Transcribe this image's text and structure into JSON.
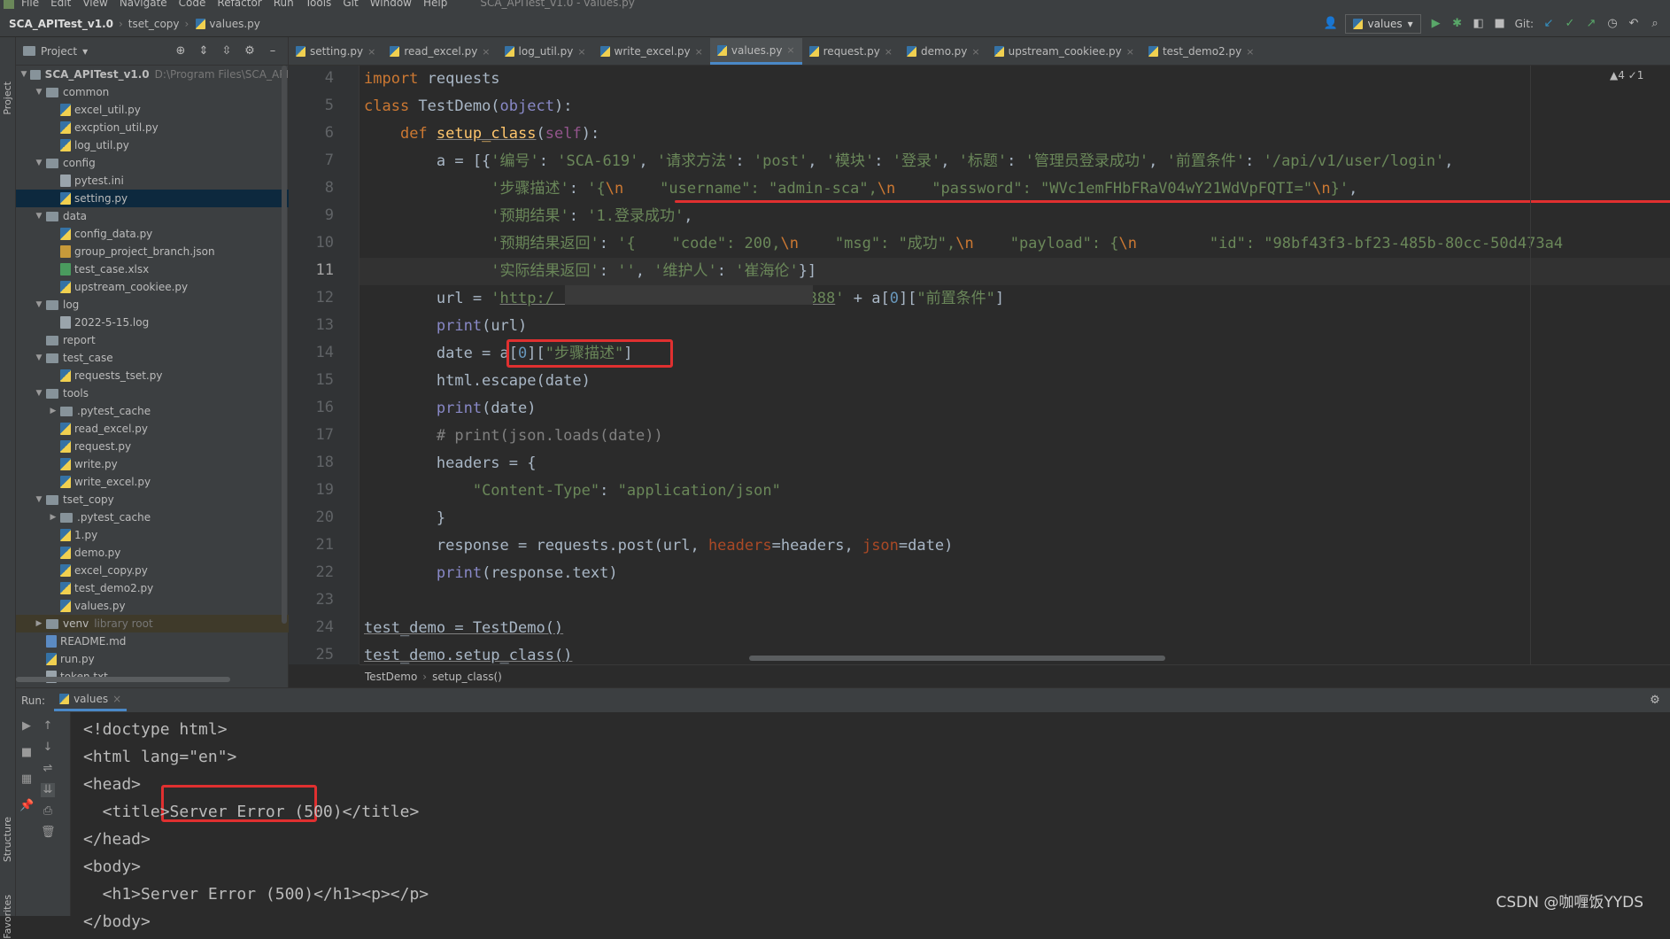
{
  "menu": {
    "items": [
      "File",
      "Edit",
      "View",
      "Navigate",
      "Code",
      "Refactor",
      "Run",
      "Tools",
      "Git",
      "Window",
      "Help"
    ],
    "window_title": "SCA_APITest_v1.0 - values.py"
  },
  "nav": {
    "project": "SCA_APITest_v1.0",
    "folder": "tset_copy",
    "file": "values.py",
    "run_config": "values",
    "git_label": "Git:"
  },
  "left_tabs": {
    "project": "Project",
    "structure": "Structure",
    "favorites": "Favorites"
  },
  "project_panel": {
    "title": "Project",
    "root": "SCA_APITest_v1.0",
    "root_path": "D:\\Program Files\\SCA_API",
    "rows": [
      {
        "label": "common",
        "kind": "folder",
        "depth": 1,
        "open": true
      },
      {
        "label": "excel_util.py",
        "kind": "py",
        "depth": 2
      },
      {
        "label": "excption_util.py",
        "kind": "py",
        "depth": 2
      },
      {
        "label": "log_util.py",
        "kind": "py",
        "depth": 2
      },
      {
        "label": "config",
        "kind": "folder",
        "depth": 1,
        "open": true
      },
      {
        "label": "pytest.ini",
        "kind": "txt",
        "depth": 2
      },
      {
        "label": "setting.py",
        "kind": "py",
        "depth": 2,
        "selected": true
      },
      {
        "label": "data",
        "kind": "folder",
        "depth": 1,
        "open": true
      },
      {
        "label": "config_data.py",
        "kind": "py",
        "depth": 2
      },
      {
        "label": "group_project_branch.json",
        "kind": "json",
        "depth": 2
      },
      {
        "label": "test_case.xlsx",
        "kind": "xls",
        "depth": 2
      },
      {
        "label": "upstream_cookiee.py",
        "kind": "py",
        "depth": 2
      },
      {
        "label": "log",
        "kind": "folder",
        "depth": 1,
        "open": true
      },
      {
        "label": "2022-5-15.log",
        "kind": "txt",
        "depth": 2
      },
      {
        "label": "report",
        "kind": "folder",
        "depth": 1
      },
      {
        "label": "test_case",
        "kind": "folder",
        "depth": 1,
        "open": true
      },
      {
        "label": "requests_tset.py",
        "kind": "py",
        "depth": 2
      },
      {
        "label": "tools",
        "kind": "folder",
        "depth": 1,
        "open": true
      },
      {
        "label": ".pytest_cache",
        "kind": "folder",
        "depth": 2,
        "closed": true
      },
      {
        "label": "read_excel.py",
        "kind": "py",
        "depth": 2
      },
      {
        "label": "request.py",
        "kind": "py",
        "depth": 2
      },
      {
        "label": "write.py",
        "kind": "py",
        "depth": 2
      },
      {
        "label": "write_excel.py",
        "kind": "py",
        "depth": 2
      },
      {
        "label": "tset_copy",
        "kind": "folder",
        "depth": 1,
        "open": true
      },
      {
        "label": ".pytest_cache",
        "kind": "folder",
        "depth": 2,
        "closed": true
      },
      {
        "label": "1.py",
        "kind": "py",
        "depth": 2
      },
      {
        "label": "demo.py",
        "kind": "py",
        "depth": 2
      },
      {
        "label": "excel_copy.py",
        "kind": "py",
        "depth": 2
      },
      {
        "label": "test_demo2.py",
        "kind": "py",
        "depth": 2
      },
      {
        "label": "values.py",
        "kind": "py",
        "depth": 2
      },
      {
        "label": "venv",
        "kind": "folder",
        "depth": 1,
        "closed": true,
        "note": "library root",
        "venv": true
      },
      {
        "label": "README.md",
        "kind": "md",
        "depth": 1
      },
      {
        "label": "run.py",
        "kind": "py",
        "depth": 1
      },
      {
        "label": "token.txt",
        "kind": "txt",
        "depth": 1
      }
    ]
  },
  "tabs": [
    "setting.py",
    "read_excel.py",
    "log_util.py",
    "write_excel.py",
    "values.py",
    "request.py",
    "demo.py",
    "upstream_cookiee.py",
    "test_demo2.py"
  ],
  "active_tab": "values.py",
  "editor": {
    "line_numbers": [
      "4",
      "5",
      "6",
      "7",
      "8",
      "9",
      "10",
      "11",
      "12",
      "13",
      "14",
      "15",
      "16",
      "17",
      "18",
      "19",
      "20",
      "21",
      "22",
      "23",
      "24",
      "25"
    ],
    "current_line": "11",
    "warnings": "▲4 ✓1",
    "breadcrumb": [
      "TestDemo",
      "setup_class()"
    ]
  },
  "run_panel": {
    "label": "Run:",
    "tab": "values",
    "output": [
      "<!doctype html>",
      "<html lang=\"en\">",
      "<head>",
      "  <title>Server Error (500)</title>",
      "</head>",
      "<body>",
      "  <h1>Server Error (500)</h1><p></p>",
      "</body>"
    ]
  },
  "watermark": "CSDN @咖喱饭YYDS"
}
